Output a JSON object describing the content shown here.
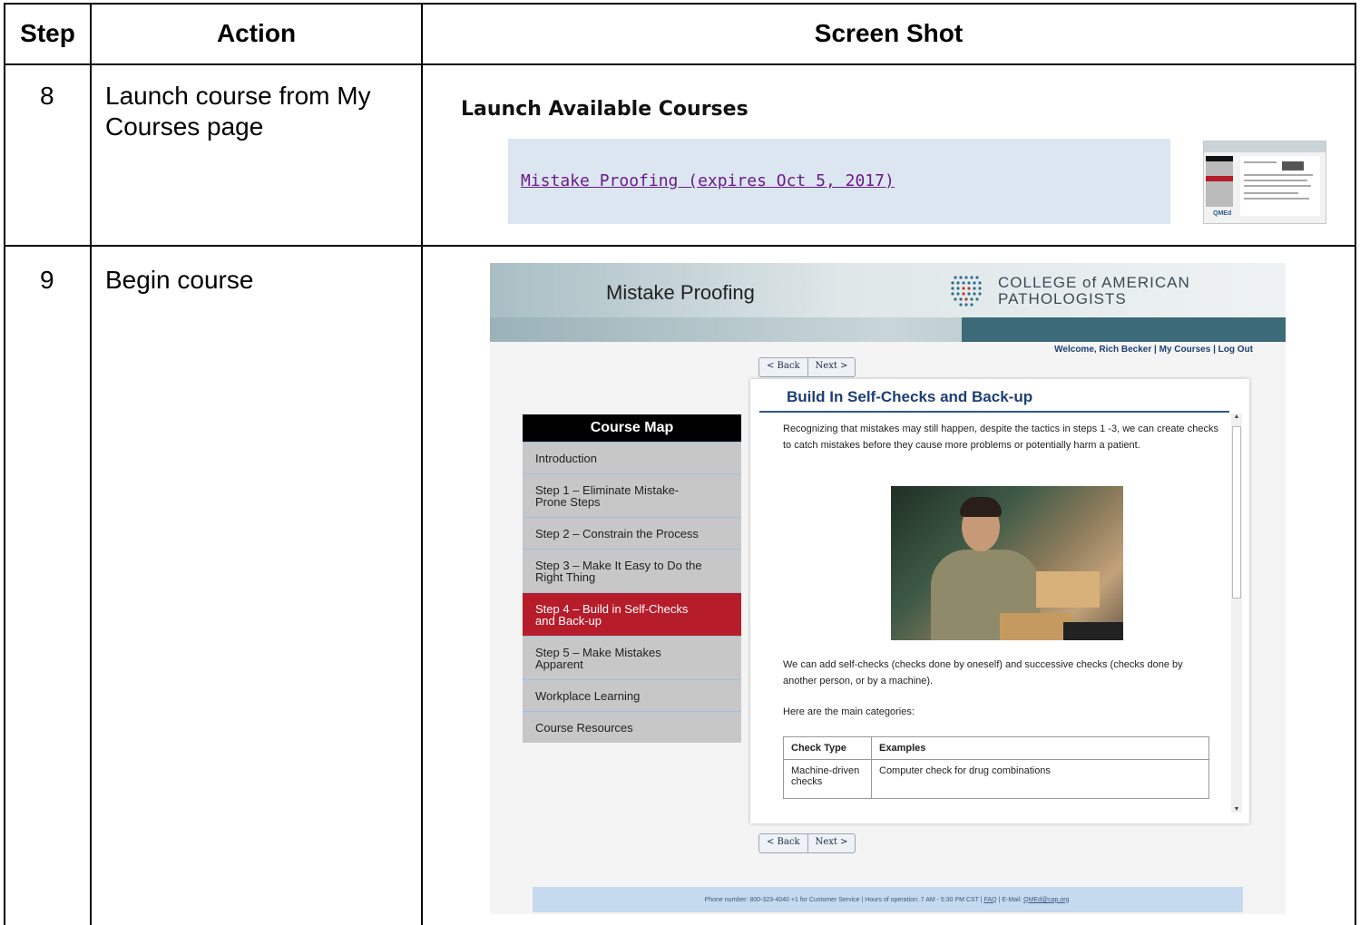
{
  "table": {
    "headers": {
      "step": "Step",
      "action": "Action",
      "screenshot": "Screen Shot"
    },
    "rows": [
      {
        "step": "8",
        "action_line1": "Launch course from My",
        "action_line2": "Courses page"
      },
      {
        "step": "9",
        "action_line1": "Begin course"
      }
    ]
  },
  "launch": {
    "title": "Launch Available Courses",
    "course_link": "Mistake Proofing (expires Oct 5, 2017)",
    "thumbnail_logo": "QMEd"
  },
  "course": {
    "title": "Mistake Proofing",
    "org_line1": "COLLEGE of AMERICAN",
    "org_line2": "PATHOLOGISTS",
    "welcome": "Welcome, Rich Becker |",
    "my_courses": "My Courses",
    "sep": "|",
    "log_out": "Log Out",
    "back_label": "< Back",
    "next_label": "Next >",
    "map_title": "Course Map",
    "map_items": [
      {
        "line1": "Introduction"
      },
      {
        "line1": "Step 1 – Eliminate Mistake-",
        "line2": "Prone Steps"
      },
      {
        "line1": "Step 2 – Constrain the Process"
      },
      {
        "line1": "Step 3 – Make It Easy to Do the",
        "line2": "Right Thing"
      },
      {
        "line1": "Step 4 – Build in Self-Checks",
        "line2": "and Back-up"
      },
      {
        "line1": "Step 5 – Make Mistakes",
        "line2": "Apparent"
      },
      {
        "line1": "Workplace Learning"
      },
      {
        "line1": "Course Resources"
      }
    ],
    "content_heading": "Build In Self-Checks and Back-up",
    "para1": "Recognizing that mistakes may still happen, despite the tactics in steps 1 -3, we can create checks to catch mistakes before they cause more problems or potentially harm a patient.",
    "para2": "We can add self-checks (checks done by oneself) and successive checks (checks done by another person, or by a machine).",
    "para3": "Here are the main categories:",
    "table_headers": [
      "Check Type",
      "Examples"
    ],
    "table_row1": [
      "Machine-driven checks",
      "Computer check for drug combinations"
    ],
    "footer_text": "Phone number: 800-323-4040 +1 for Customer Service | Hours of operation: 7 AM - 5:30 PM CST |",
    "footer_faq": "FAQ",
    "footer_mid": "| E-Mail:",
    "footer_email": "QMEd@cap.org"
  }
}
